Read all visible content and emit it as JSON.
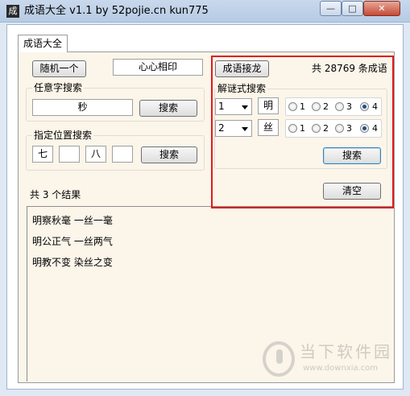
{
  "window": {
    "title": "成语大全 v1.1 by 52pojie.cn kun775",
    "icon_glyph": "成",
    "minimize_glyph": "—",
    "maximize_glyph": "□",
    "close_glyph": "✕"
  },
  "tab": {
    "label": "成语大全"
  },
  "random": {
    "button_label": "随机一个",
    "result": "心心相印"
  },
  "any_char_search": {
    "group_label": "任意字搜索",
    "input_value": "秒",
    "button_label": "搜索"
  },
  "position_search": {
    "group_label": "指定位置搜索",
    "inputs": [
      "七",
      "",
      "八",
      ""
    ],
    "button_label": "搜索"
  },
  "relay": {
    "button_label": "成语接龙",
    "count_text": "共 28769 条成语"
  },
  "riddle_search": {
    "group_label": "解谜式搜索",
    "rows": [
      {
        "select_value": "1",
        "char": "明",
        "options": [
          "1",
          "2",
          "3",
          "4"
        ],
        "selected_index": 3
      },
      {
        "select_value": "2",
        "char": "丝",
        "options": [
          "1",
          "2",
          "3",
          "4"
        ],
        "selected_index": 3
      }
    ],
    "button_label": "搜索"
  },
  "clear_button": {
    "label": "清空"
  },
  "results": {
    "summary": "共 3 个结果",
    "lines": [
      "明察秋毫 一丝一毫",
      "明公正气 一丝两气",
      "明教不变 染丝之变"
    ]
  },
  "watermark": {
    "brand": "当下软件园",
    "url": "www.downxia.com"
  },
  "colors": {
    "highlight_border": "#e01b1b",
    "panel_bg": "#fbf5ea",
    "frame_bg": "#dfe8f3"
  }
}
